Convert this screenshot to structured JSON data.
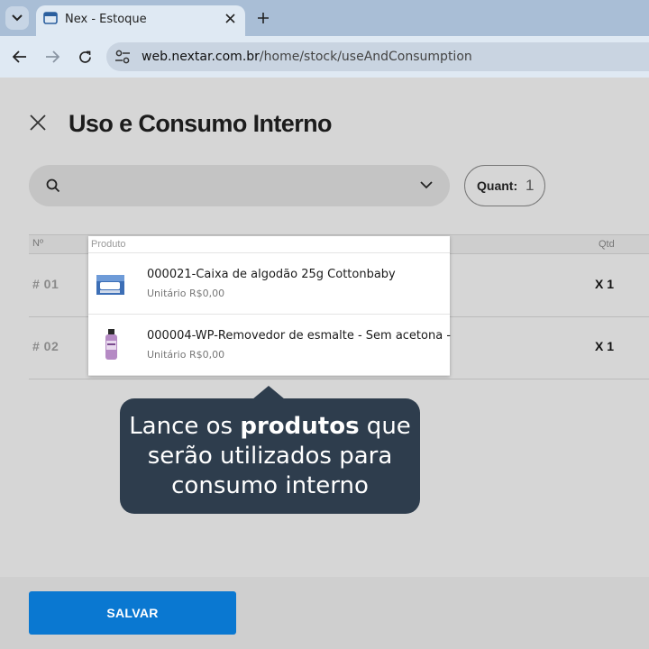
{
  "browser": {
    "tab_title": "Nex - Estoque",
    "url_host": "web.nextar.com.br",
    "url_path": "/home/stock/useAndConsumption"
  },
  "page": {
    "title": "Uso e Consumo Interno",
    "search": {
      "placeholder": ""
    },
    "quant": {
      "label": "Quant:",
      "value": "1"
    },
    "table": {
      "headers": {
        "no": "Nº",
        "qtd": "Qtd"
      },
      "rows": [
        {
          "num": "# 01",
          "qty": "X 1"
        },
        {
          "num": "# 02",
          "qty": "X 1"
        }
      ]
    }
  },
  "dropdown": {
    "header": "Produto",
    "items": [
      {
        "name": "000021-Caixa de algodão 25g Cottonbaby",
        "price": "Unitário R$0,00",
        "thumb_icon": "cotton-box-icon"
      },
      {
        "name": "000004-WP-Removedor de esmalte - Sem acetona -",
        "price": "Unitário R$0,00",
        "thumb_icon": "nail-polish-remover-bottle-icon"
      }
    ]
  },
  "tooltip": {
    "part1": "Lance os ",
    "bold": "produtos",
    "part2": " que serão utilizados para consumo interno"
  },
  "footer": {
    "save_label": "SALVAR"
  },
  "colors": {
    "accent": "#0a78d1",
    "tooltip_bg": "#2e3d4d",
    "tab_bar": "#a9bed6"
  }
}
